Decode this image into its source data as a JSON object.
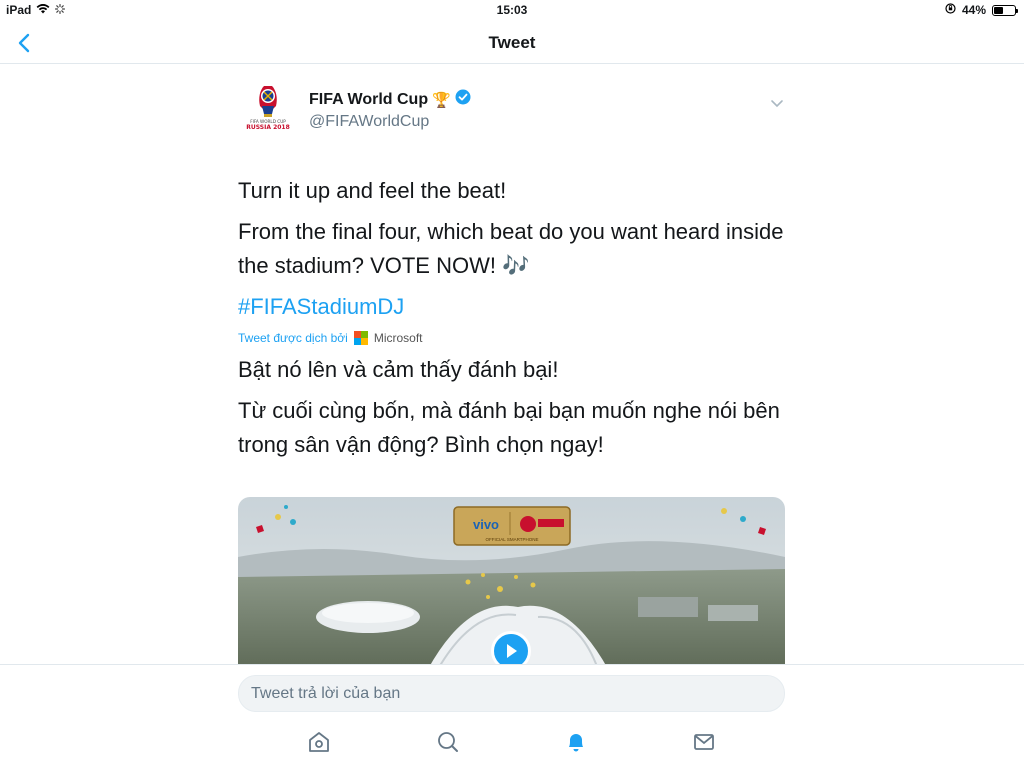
{
  "status_bar": {
    "device": "iPad",
    "time": "15:03",
    "battery": "44%",
    "battery_level": 0.44
  },
  "nav": {
    "title": "Tweet",
    "back_icon": "chevron-left-icon"
  },
  "tweet": {
    "author_name": "FIFA World Cup",
    "author_emoji": "🏆",
    "handle": "@FIFAWorldCup",
    "verified": true,
    "text_line1": "Turn it up and feel the beat!",
    "text_line2": "From the final four, which beat do you want heard inside the stadium? VOTE NOW! 🎶",
    "hashtag": "#FIFAStadiumDJ",
    "translated_by": "Tweet được dịch bởi",
    "translator": "Microsoft",
    "translation_line1": "Bật nó lên và cảm thấy đánh bại!",
    "translation_line2": "Từ cuối cùng bốn, mà đánh bại bạn muốn nghe nói bên trong sân vận động? Bình chọn ngay!",
    "media_overlay": "vivo",
    "media_overlay_sub": "OFFICIAL SMARTPHONE"
  },
  "reply": {
    "placeholder": "Tweet trả lời của bạn"
  },
  "tabs": [
    {
      "icon": "home-icon"
    },
    {
      "icon": "search-icon"
    },
    {
      "icon": "notifications-icon"
    },
    {
      "icon": "messages-icon"
    }
  ],
  "colors": {
    "accent": "#1da1f2",
    "text": "#14171a",
    "secondary": "#657786"
  }
}
